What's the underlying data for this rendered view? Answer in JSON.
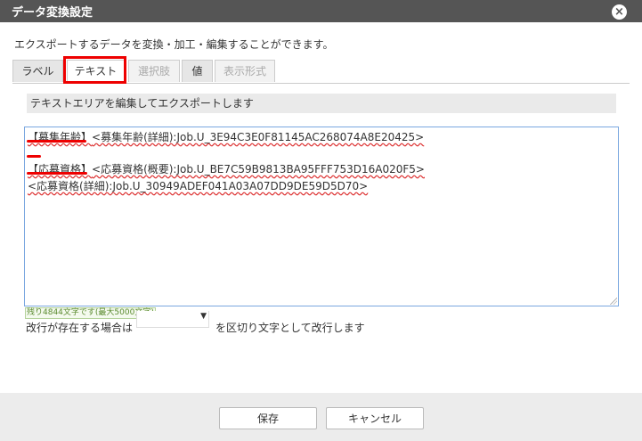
{
  "dialog": {
    "title": "データ変換設定",
    "close_icon": "×"
  },
  "description": "エクスポートするデータを変換・加工・編集することができます。",
  "tabs": [
    {
      "label": "ラベル",
      "state": "normal"
    },
    {
      "label": "テキスト",
      "state": "active"
    },
    {
      "label": "選択肢",
      "state": "disabled"
    },
    {
      "label": "値",
      "state": "normal"
    },
    {
      "label": "表示形式",
      "state": "disabled"
    }
  ],
  "hint": "テキストエリアを編集してエクスポートします",
  "editor": {
    "lines": [
      {
        "label": "【募集年齢】",
        "rest": "<募集年齢(詳細):Job.U_3E94C3E0F81145AC268074A8E20425>"
      },
      {
        "label": "",
        "rest": ""
      },
      {
        "label": "【応募資格】",
        "rest": "<応募資格(概要):Job.U_BE7C59B9813BA95FFF753D16A020F5>"
      },
      {
        "label": "",
        "rest": "<応募資格(詳細):Job.U_30949ADEF041A03A07DD9DE59D5D70>"
      }
    ]
  },
  "counter": "残り4844文字です(最大5000文字)",
  "newline_row": {
    "prefix": "改行が存在する場合は",
    "select_value": "",
    "suffix": "を区切り文字として改行します"
  },
  "buttons": {
    "save": "保存",
    "cancel": "キャンセル"
  },
  "colors": {
    "annotation": "#e00000",
    "titlebar": "#555555"
  }
}
